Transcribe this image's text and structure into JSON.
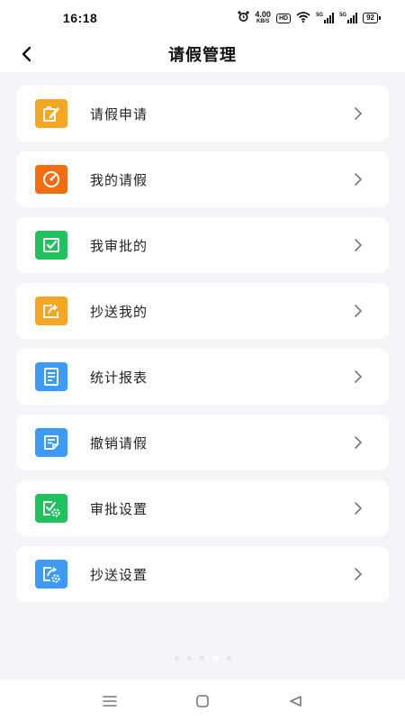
{
  "status_bar": {
    "time": "16:18",
    "net_speed_value": "4.00",
    "net_speed_unit": "KB/S",
    "hd_label": "HD",
    "sim1_label": "5G",
    "sim2_label": "5G",
    "battery": "92"
  },
  "header": {
    "title": "请假管理"
  },
  "menu": {
    "items": [
      {
        "label": "请假申请",
        "icon": "apply-form-icon",
        "color": "#f5a623"
      },
      {
        "label": "我的请假",
        "icon": "gauge-icon",
        "color": "#f26c12"
      },
      {
        "label": "我审批的",
        "icon": "checkbox-check-icon",
        "color": "#22c15e"
      },
      {
        "label": "抄送我的",
        "icon": "share-arrow-icon",
        "color": "#f5a623"
      },
      {
        "label": "统计报表",
        "icon": "report-sheet-icon",
        "color": "#3d9bf5"
      },
      {
        "label": "撤销请假",
        "icon": "revoke-doc-icon",
        "color": "#3d9bf5"
      },
      {
        "label": "审批设置",
        "icon": "approval-settings-icon",
        "color": "#22c15e"
      },
      {
        "label": "抄送设置",
        "icon": "share-settings-icon",
        "color": "#3d9bf5"
      }
    ]
  },
  "page_indicator": {
    "count": 5,
    "active_index": 3
  },
  "system_nav": {
    "icons": [
      "menu-lines-icon",
      "home-square-icon",
      "back-triangle-icon"
    ]
  }
}
